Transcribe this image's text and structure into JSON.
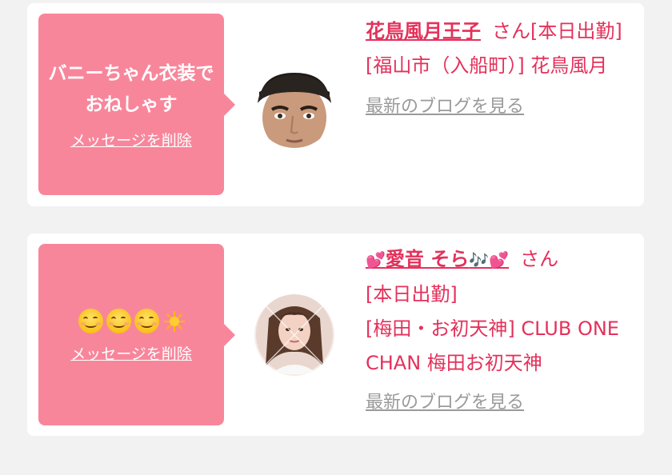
{
  "messages": [
    {
      "bubble_text": "バニーちゃん衣装でおねしゃす",
      "delete_label": "メッセージを削除",
      "name": "花鳥風月王子",
      "honorific": "さん",
      "status": "[本日出勤]",
      "location": "[福山市（入船町）] 花鳥風月",
      "blog_label": "最新のブログを見る",
      "avatar_icon": "avatar-man-icon"
    },
    {
      "bubble_emoji": [
        "smiling-face-icon",
        "smiling-face-icon",
        "smiling-face-icon",
        "sun-icon"
      ],
      "delete_label": "メッセージを削除",
      "name_prefix_emoji": "💕",
      "name": "愛音 そら",
      "name_suffix_emoji": "🎶💕",
      "honorific": "さん",
      "status": "[本日出勤]",
      "location": "[梅田・お初天神] CLUB ONE CHAN 梅田お初天神",
      "blog_label": "最新のブログを見る",
      "avatar_icon": "avatar-woman-icon"
    }
  ],
  "colors": {
    "accent": "#e4315b",
    "bubble": "#f8869b",
    "background": "#f2f2f2",
    "link_gray": "#9a9a9a"
  }
}
